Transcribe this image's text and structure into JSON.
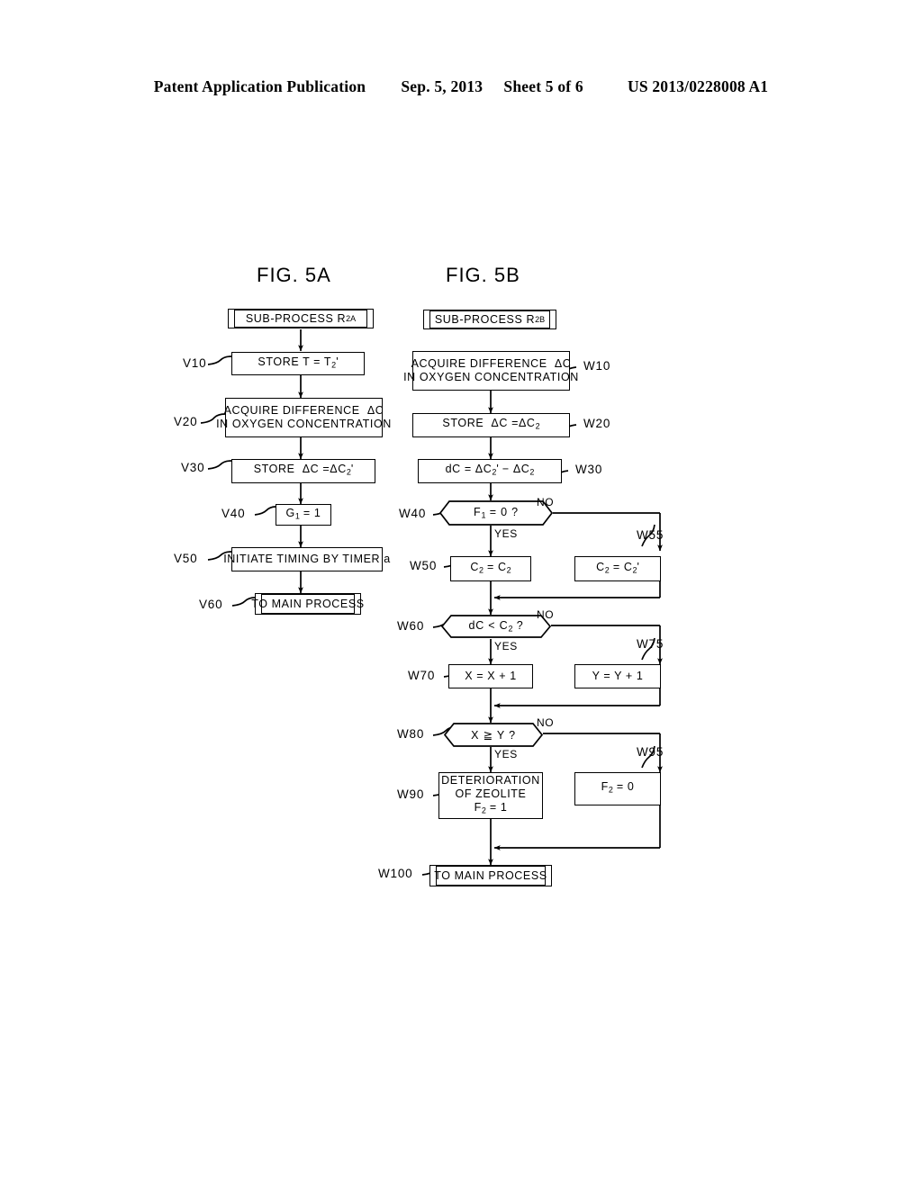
{
  "header": {
    "publication": "Patent Application Publication",
    "date": "Sep. 5, 2013",
    "sheet": "Sheet 5 of 6",
    "number": "US 2013/0228008 A1"
  },
  "figures": [
    {
      "title": "FIG. 5A",
      "start": {
        "ref": "",
        "text": "SUB-PROCESS R2A"
      },
      "steps": [
        {
          "ref": "V10",
          "lines": [
            "STORE T = T2'"
          ]
        },
        {
          "ref": "V20",
          "lines": [
            "ACQUIRE DIFFERENCE ΔC",
            "IN OXYGEN CONCENTRATION"
          ]
        },
        {
          "ref": "V30",
          "lines": [
            "STORE ΔC =ΔC2'"
          ]
        },
        {
          "ref": "V40",
          "lines": [
            "G1 = 1"
          ]
        },
        {
          "ref": "V50",
          "lines": [
            "INITIATE TIMING BY TIMER a"
          ]
        },
        {
          "ref": "V60",
          "lines": [
            "TO MAIN PROCESS"
          ]
        }
      ]
    },
    {
      "title": "FIG. 5B",
      "start": {
        "ref": "",
        "text": "SUB-PROCESS R2B"
      },
      "steps": [
        {
          "ref": "W10",
          "lines": [
            "ACQUIRE DIFFERENCE ΔC",
            "IN OXYGEN CONCENTRATION"
          ]
        },
        {
          "ref": "W20",
          "lines": [
            "STORE ΔC =ΔC2"
          ]
        },
        {
          "ref": "W30",
          "lines": [
            "dC = ΔC2' - ΔC2"
          ]
        },
        {
          "ref": "W40",
          "lines": [
            "F1 = 0 ?"
          ],
          "yes": "YES",
          "no": "NO"
        },
        {
          "ref": "W50",
          "lines": [
            "C2 = C2"
          ]
        },
        {
          "ref": "W55",
          "lines": [
            "C2 = C2'"
          ]
        },
        {
          "ref": "W60",
          "lines": [
            "dC < C2 ?"
          ],
          "yes": "YES",
          "no": "NO"
        },
        {
          "ref": "W70",
          "lines": [
            "X = X + 1"
          ]
        },
        {
          "ref": "W75",
          "lines": [
            "Y = Y + 1"
          ]
        },
        {
          "ref": "W80",
          "lines": [
            "X ≧ Y ?"
          ],
          "yes": "YES",
          "no": "NO"
        },
        {
          "ref": "W90",
          "lines": [
            "DETERIORATION",
            "OF ZEOLITE",
            "F2 = 1"
          ]
        },
        {
          "ref": "W95",
          "lines": [
            "F2 = 0"
          ]
        },
        {
          "ref": "W100",
          "lines": [
            "TO MAIN PROCESS"
          ]
        }
      ]
    }
  ],
  "labels": {
    "fig5a_title": "FIG. 5A",
    "fig5b_title": "FIG. 5B",
    "a_start": "SUB-PROCESS R",
    "a_start_sub": "2A",
    "b_start": "SUB-PROCESS R",
    "b_start_sub": "2B",
    "v10_ref": "V10",
    "v20_ref": "V20",
    "v30_ref": "V30",
    "v40_ref": "V40",
    "v50_ref": "V50",
    "v60_ref": "V60",
    "w10_ref": "W10",
    "w20_ref": "W20",
    "w30_ref": "W30",
    "w40_ref": "W40",
    "w50_ref": "W50",
    "w55_ref": "W55",
    "w60_ref": "W60",
    "w70_ref": "W70",
    "w75_ref": "W75",
    "w80_ref": "W80",
    "w90_ref": "W90",
    "w95_ref": "W95",
    "w100_ref": "W100",
    "v10_text": "STORE T = T",
    "v10_sub": "2",
    "v10_prime": "'",
    "acquire_l1": "ACQUIRE DIFFERENCE",
    "acquire_delta": "ΔC",
    "acquire_l2": "IN OXYGEN CONCENTRATION",
    "v30_text": "STORE",
    "v30_d1": "ΔC",
    "v30_eq": "=",
    "v30_d2": "ΔC",
    "v30_sub": "2",
    "v30_prime": "'",
    "v40_text": "G",
    "v40_sub": "1",
    "v40_rest": " = 1",
    "v50_text": "INITIATE TIMING BY TIMER a",
    "to_main": "TO MAIN PROCESS",
    "w20_text": "STORE",
    "w20_d1": "ΔC",
    "w20_eq": "=",
    "w20_d2": "ΔC",
    "w20_sub": "2",
    "w30_dc": "dC  =",
    "w30_a": "ΔC",
    "w30_asub": "2",
    "w30_aprime": "'",
    "w30_minus": "−",
    "w30_b": "ΔC",
    "w30_bsub": "2",
    "w40_f": "F",
    "w40_sub": "1",
    "w40_rest": " = 0 ?",
    "w50_c": "C",
    "w50_sub1": "2",
    "w50_eq": " = C",
    "w50_sub2": "2",
    "w55_c": "C",
    "w55_sub1": "2",
    "w55_eq": " = C",
    "w55_sub2": "2",
    "w55_prime": "'",
    "w60_dc": "dC  <  C",
    "w60_sub": "2",
    "w60_q": " ?",
    "w70_text": "X = X + 1",
    "w75_text": "Y = Y + 1",
    "w80_text": "X ≧ Y ?",
    "w90_l1": "DETERIORATION",
    "w90_l2": "OF ZEOLITE",
    "w90_f": "F",
    "w90_sub": "2",
    "w90_rest": " = 1",
    "w95_f": "F",
    "w95_sub": "2",
    "w95_rest": " = 0",
    "yes": "YES",
    "no": "NO"
  },
  "colors": {
    "ink": "#000000",
    "paper": "#ffffff"
  }
}
